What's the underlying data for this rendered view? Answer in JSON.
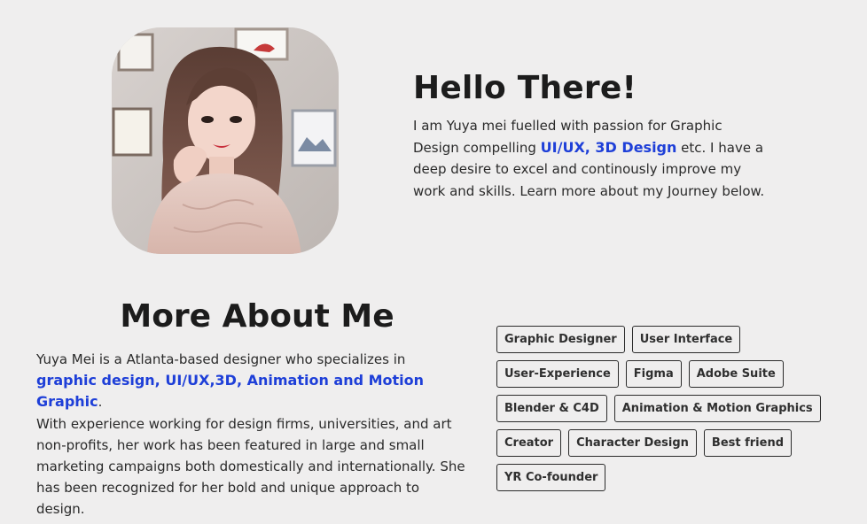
{
  "hero": {
    "title": "Hello There!",
    "intro_before": "I am Yuya mei fuelled with passion for Graphic Design compelling ",
    "intro_highlight": "UI/UX, 3D Design",
    "intro_after": " etc. I have a deep desire to excel and continously improve my work and skills. Learn more about my Journey below."
  },
  "about": {
    "title": "More About Me",
    "text_before": "Yuya Mei is a Atlanta-based designer who specializes in ",
    "text_highlight": "graphic design, UI/UX,3D, Animation and Motion Graphic",
    "text_after": ".",
    "text_second": "With experience working for design firms, universities, and art non-profits, her work has been featured in large and small marketing campaigns both domestically and internationally. She has been recognized for her bold and unique approach to design."
  },
  "tags": [
    "Graphic Designer",
    "User Interface",
    "User-Experience",
    "Figma",
    "Adobe Suite",
    "Blender & C4D",
    "Animation & Motion Graphics",
    "Creator",
    "Character Design",
    "Best friend",
    "YR Co-founder"
  ],
  "colors": {
    "background": "#efeeee",
    "accent": "#1e3fd8",
    "text": "#222222"
  }
}
